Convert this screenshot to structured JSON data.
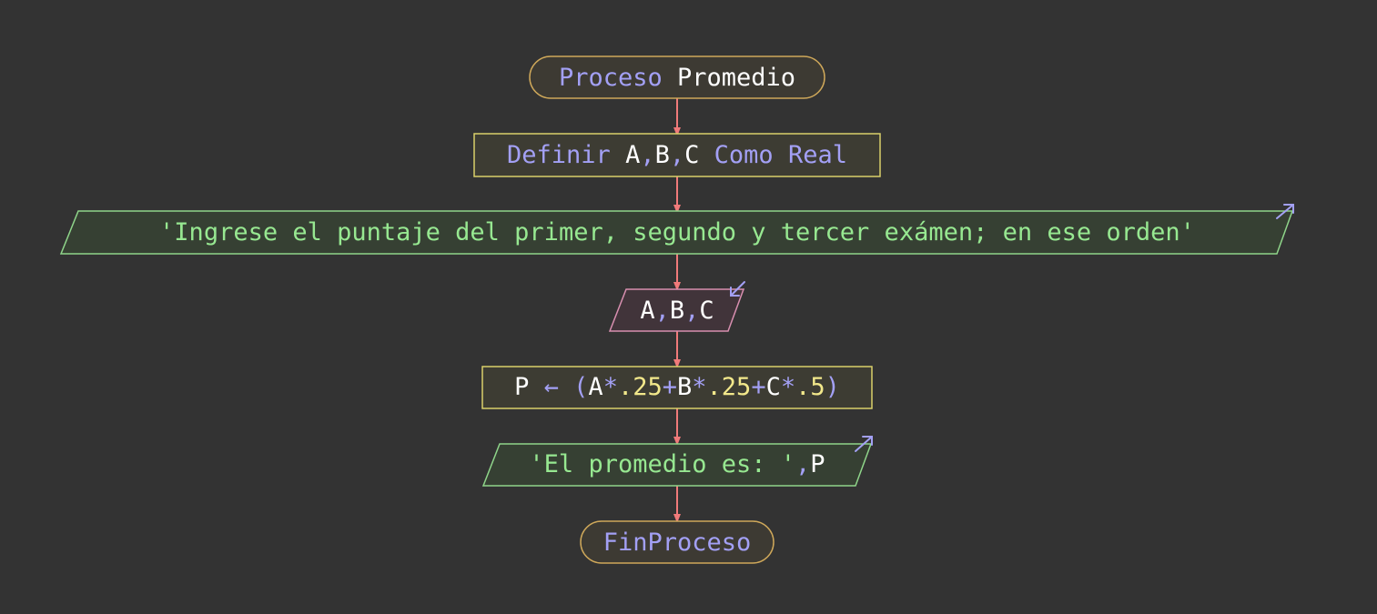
{
  "colors": {
    "background": "#333333",
    "keyword": "#a3a0f5",
    "identifier": "#ffffff",
    "number": "#f2e88b",
    "string": "#97e891",
    "arrow": "#f07a7a",
    "terminal_border": "#cfa85a",
    "process_border": "#d9d06a",
    "io_border": "#8fd58a",
    "read_border": "#d88fb0"
  },
  "flowchart": {
    "start": {
      "keyword": "Proceso",
      "name": "Promedio"
    },
    "define": {
      "keyword": "Definir",
      "vars": [
        "A",
        "B",
        "C"
      ],
      "separator": ",",
      "as_keyword": "Como",
      "type": "Real"
    },
    "write_prompt": {
      "text": "'Ingrese el puntaje del primer, segundo y tercer exámen; en ese orden'",
      "icon": "output-arrow-icon"
    },
    "read": {
      "vars": [
        "A",
        "B",
        "C"
      ],
      "separator": ",",
      "icon": "input-arrow-icon"
    },
    "assign": {
      "target": "P",
      "arrow": "←",
      "open_paren": "(",
      "term1_var": "A",
      "term1_op": "*",
      "term1_num": ".25",
      "plus1": "+",
      "term2_var": "B",
      "term2_op": "*",
      "term2_num": ".25",
      "plus2": "+",
      "term3_var": "C",
      "term3_op": "*",
      "term3_num": ".5",
      "close_paren": ")"
    },
    "write_result": {
      "string": "'El promedio es: '",
      "separator": ",",
      "var": "P",
      "icon": "output-arrow-icon"
    },
    "end": {
      "keyword": "FinProceso"
    }
  }
}
